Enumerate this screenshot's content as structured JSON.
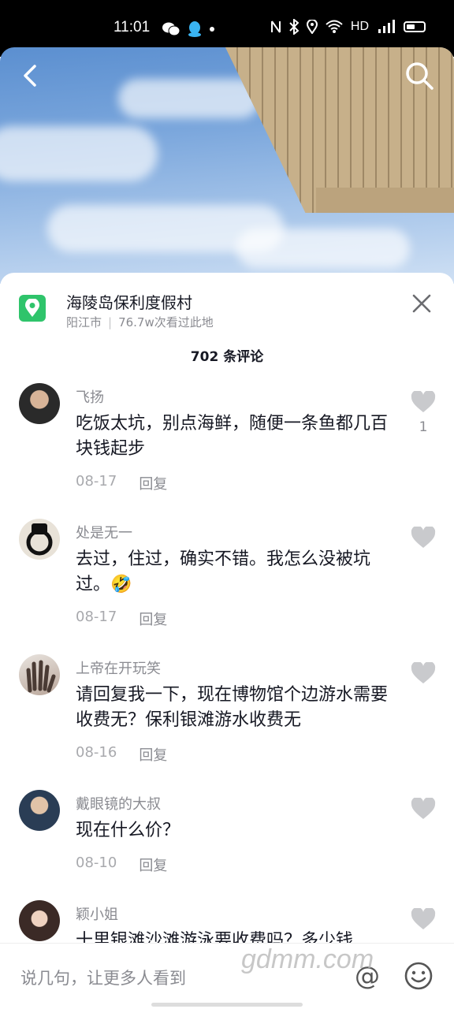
{
  "status_bar": {
    "time": "11:01",
    "network": "HD"
  },
  "nav": {
    "back_icon": "chevron-left-icon",
    "search_icon": "search-icon"
  },
  "location": {
    "title": "海陵岛保利度假村",
    "city": "阳江市",
    "views": "76.7w次看过此地",
    "icon": "map-pin-icon",
    "accent": "#2fc46b"
  },
  "comments_count": "702 条评论",
  "comments": [
    {
      "name": "飞扬",
      "text": "吃饭太坑，别点海鲜，随便一条鱼都几百块钱起步",
      "date": "08-17",
      "reply": "回复",
      "likes": "1"
    },
    {
      "name": "处是无一",
      "text": "去过，住过，确实不错。我怎么没被坑过。🤣",
      "date": "08-17",
      "reply": "回复",
      "likes": ""
    },
    {
      "name": "上帝在开玩笑",
      "text": "请回复我一下，现在博物馆个边游水需要收费无？保利银滩游水收费无",
      "date": "08-16",
      "reply": "回复",
      "likes": ""
    },
    {
      "name": "戴眼镜的大叔",
      "text": "现在什么价？",
      "date": "08-10",
      "reply": "回复",
      "likes": ""
    },
    {
      "name": "颖小姐",
      "text": "十里银滩沙滩游泳要收费吗？多少钱",
      "date": "",
      "reply": "",
      "likes": ""
    }
  ],
  "input": {
    "placeholder": "说几句，让更多人看到"
  },
  "watermark": "gdmm.com"
}
